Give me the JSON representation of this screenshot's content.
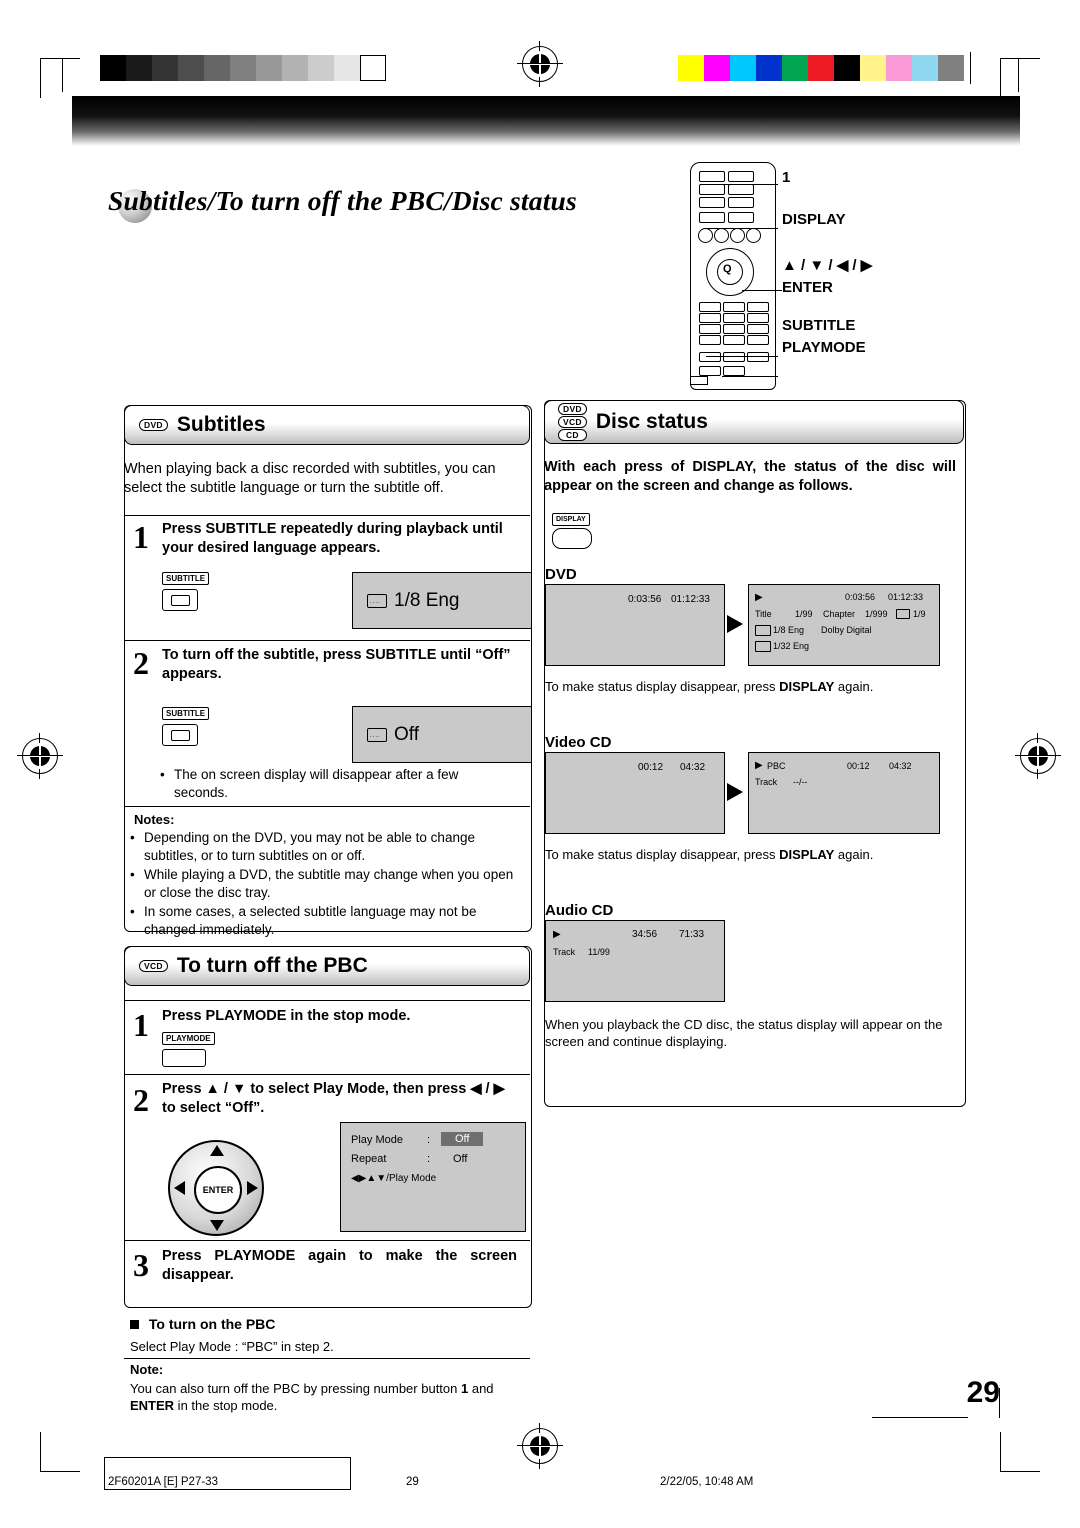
{
  "page": {
    "title": "Subtitles/To turn off the PBC/Disc status",
    "page_number": "29",
    "footer_left": "2F60201A [E] P27-33",
    "footer_center": "29",
    "footer_right": "2/22/05, 10:48 AM"
  },
  "remote": {
    "callout_number": "1",
    "labels": [
      "DISPLAY",
      "▲ / ▼ / ◀ / ▶",
      "ENTER",
      "SUBTITLE",
      "PLAYMODE"
    ],
    "enter_label": "Q"
  },
  "subtitles": {
    "badge": "DVD",
    "heading": "Subtitles",
    "intro": "When playing back a disc recorded with subtitles, you can select the subtitle language or turn the subtitle off.",
    "step1_num": "1",
    "step1_text": "Press SUBTITLE repeatedly during playback until your desired language appears.",
    "step1_button": "SUBTITLE",
    "step1_osd": "1/8 Eng",
    "step2_num": "2",
    "step2_text": "To turn off the subtitle, press SUBTITLE until “Off” appears.",
    "step2_button": "SUBTITLE",
    "step2_osd": "Off",
    "step2_bullet": "The on screen display will disappear after a few seconds.",
    "notes_label": "Notes:",
    "notes": [
      "Depending on the DVD, you may not be able to change subtitles, or to turn subtitles on or off.",
      "While playing a DVD, the subtitle may change when you open or close the disc tray.",
      "In some cases, a selected subtitle language may not be changed immediately."
    ]
  },
  "pbc": {
    "badge": "VCD",
    "heading": "To turn off the PBC",
    "step1_num": "1",
    "step1_text": "Press PLAYMODE in the stop mode.",
    "step1_button": "PLAYMODE",
    "step2_num": "2",
    "step2_text": "Press ▲ / ▼ to select Play Mode, then press ◀ / ▶ to select “Off”.",
    "step2_enter": "ENTER",
    "osd": {
      "row1_label": "Play Mode",
      "row1_colon": ":",
      "row1_value": "Off",
      "row2_label": "Repeat",
      "row2_colon": ":",
      "row2_value": "Off",
      "row3": "◀▶▲▼/Play Mode"
    },
    "step3_num": "3",
    "step3_text": "Press PLAYMODE again to make the screen disappear.",
    "subhead": "To turn on the PBC",
    "subtext": "Select Play Mode : “PBC” in step 2.",
    "note_label": "Note:",
    "note_text_1": "You can also turn off the PBC by pressing number button ",
    "note_bold_1": "1",
    "note_text_2": " and ",
    "note_bold_2": "ENTER",
    "note_text_3": " in the stop mode."
  },
  "disc_status": {
    "badges": [
      "DVD",
      "VCD",
      "CD"
    ],
    "heading": "Disc status",
    "intro": "With each press of DISPLAY, the status of the disc will appear on the screen and change as follows.",
    "display_button": "DISPLAY",
    "dvd": {
      "label": "DVD",
      "screen1": {
        "time1": "0:03:56",
        "time2": "01:12:33"
      },
      "screen2": {
        "play": "▶",
        "time1": "0:03:56",
        "time2": "01:12:33",
        "title_label": "Title",
        "title_value": "1/99",
        "chapter_label": "Chapter",
        "chapter_value": "1/999",
        "angle_value": "1/9",
        "subtitle_value": "1/8  Eng",
        "audio_value": "Dolby Digital",
        "audio2_value": "1/32  Eng"
      },
      "caption_1": "To make status display disappear, press ",
      "caption_bold": "DISPLAY",
      "caption_2": " again."
    },
    "vcd": {
      "label": "Video CD",
      "screen1": {
        "time1": "00:12",
        "time2": "04:32"
      },
      "screen2": {
        "play": "▶",
        "pbc": "PBC",
        "time1": "00:12",
        "time2": "04:32",
        "track_label": "Track",
        "track_value": "--/--"
      },
      "caption_1": "To make status display disappear, press ",
      "caption_bold": "DISPLAY",
      "caption_2": " again."
    },
    "cd": {
      "label": "Audio CD",
      "screen": {
        "play": "▶",
        "time1": "34:56",
        "time2": "71:33",
        "track_label": "Track",
        "track_value": "11/99"
      },
      "caption": "When you playback the CD disc, the status display will appear on the screen and continue displaying."
    }
  }
}
